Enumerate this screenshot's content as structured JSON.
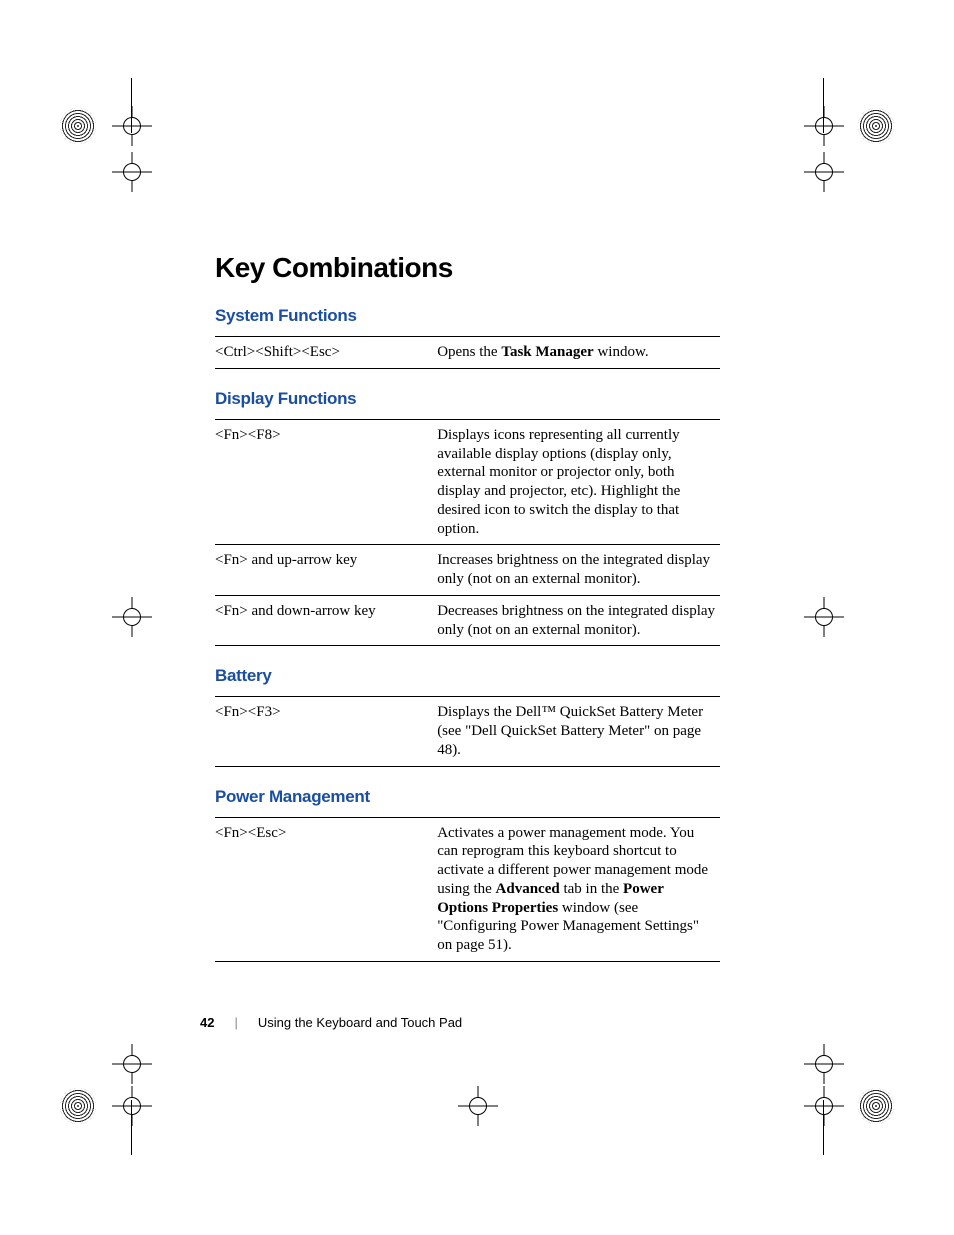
{
  "page": {
    "title": "Key Combinations",
    "number": "42",
    "footer_text": "Using the Keyboard and Touch Pad"
  },
  "sections": {
    "system": {
      "heading": "System Functions",
      "row1_key": "<Ctrl><Shift><Esc>",
      "row1_desc_a": "Opens the ",
      "row1_desc_b": "Task Manager",
      "row1_desc_c": " window."
    },
    "display": {
      "heading": "Display Functions",
      "row1_key": "<Fn><F8>",
      "row1_desc": "Displays icons representing all currently available display options (display only, external monitor or projector only, both display and projector, etc). Highlight the desired icon to switch the display to that option.",
      "row2_key": "<Fn> and up-arrow key",
      "row2_desc": "Increases brightness on the integrated display only (not on an external monitor).",
      "row3_key": "<Fn> and down-arrow key",
      "row3_desc": "Decreases brightness on the integrated display only (not on an external monitor)."
    },
    "battery": {
      "heading": "Battery",
      "row1_key": "<Fn><F3>",
      "row1_desc": "Displays the Dell™ QuickSet Battery Meter (see \"Dell QuickSet Battery Meter\" on page 48)."
    },
    "power": {
      "heading": "Power Management",
      "row1_key": "<Fn><Esc>",
      "row1_desc_a": "Activates a power management mode. You can reprogram this keyboard shortcut to activate a different power management mode using the ",
      "row1_desc_b": "Advanced",
      "row1_desc_c": " tab in the ",
      "row1_desc_d": "Power Options Properties",
      "row1_desc_e": " window (see \"Configuring Power Management Settings\" on page 51)."
    }
  }
}
